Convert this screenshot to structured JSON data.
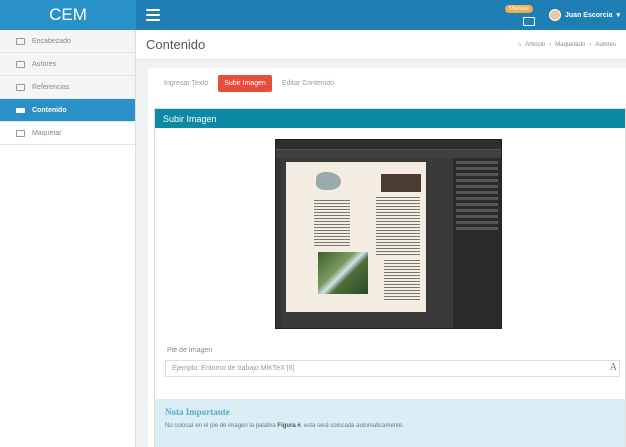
{
  "app": {
    "brand": "CEM"
  },
  "navbar": {
    "manual_badge": "Manual",
    "user_name": "Juan Escorcia"
  },
  "sidebar": {
    "items": [
      {
        "label": "Encabezado",
        "icon": "header-icon"
      },
      {
        "label": "Autores",
        "icon": "users-icon"
      },
      {
        "label": "Referencias",
        "icon": "pencil-icon"
      },
      {
        "label": "Contenido",
        "icon": "list-icon",
        "active": true
      },
      {
        "label": "Maquetar",
        "icon": "layout-icon"
      }
    ]
  },
  "header": {
    "title": "Contenido",
    "breadcrumb": [
      "Articulo",
      "Maquetado",
      "Autores"
    ]
  },
  "tabs": [
    {
      "label": "Ingresar Texto"
    },
    {
      "label": "Subir Imagen",
      "active": true
    },
    {
      "label": "Editar Contenido"
    }
  ],
  "panel": {
    "title": "Subir Imagen"
  },
  "caption": {
    "label": "Pie de Imagen",
    "placeholder": "Ejemplo: Entorno de trabajo MiKTeX [6]"
  },
  "note": {
    "title": "Nota Importante",
    "text_before": "No colocar en el pie de imagen la palabra ",
    "text_bold": "Figura #",
    "text_after": ", esta será colocada automaticamente."
  },
  "colors": {
    "navbar": "#1f7fb5",
    "active": "#2a90c8",
    "panel_heading": "#0c8aa3",
    "tab_active": "#e74c3c"
  }
}
